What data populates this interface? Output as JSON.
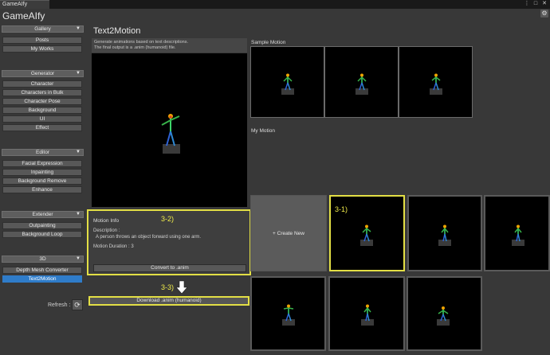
{
  "window": {
    "tab_label": "GameAIfy",
    "title": "GameAIfy",
    "controls": [
      "⋮",
      "□",
      "✕"
    ],
    "settings_icon": "gear-icon"
  },
  "sidebar": {
    "sections": [
      {
        "label": "Gallery",
        "items": [
          "Posts",
          "My Works"
        ]
      },
      {
        "label": "Generator",
        "items": [
          "Character",
          "Characters in Bulk",
          "Character Pose",
          "Background",
          "UI",
          "Effect"
        ]
      },
      {
        "label": "Editor",
        "items": [
          "Facial Expression",
          "Inpainting",
          "Background Remove",
          "Enhance"
        ]
      },
      {
        "label": "Extender",
        "items": [
          "Outpainting",
          "Background Loop"
        ]
      },
      {
        "label": "3D",
        "items": [
          "Depth Mesh Converter",
          "Text2Motion"
        ]
      }
    ],
    "active_item": "Text2Motion",
    "refresh_label": "Refresh :",
    "refresh_icon": "refresh-icon"
  },
  "main": {
    "title": "Text2Motion",
    "description_line1": "Generate animations based on text descriptions.",
    "description_line2": "The final output is a .anim (humanoid) file.",
    "motion_info": {
      "title": "Motion Info",
      "description_label": "Description :",
      "description": "A person throws an object forward using one arm.",
      "duration": "Motion Duration : 3"
    },
    "convert_label": "Convert to .anim",
    "download_label": "Download .anim (humanoid)"
  },
  "annotations": {
    "a1": "3-1)",
    "a2": "3-2)",
    "a3": "3-3)"
  },
  "sample_motion": {
    "label": "Sample Motion",
    "count": 3
  },
  "my_motion": {
    "label": "My Motion",
    "create_new": "+ Create New",
    "count": 7
  },
  "colors": {
    "accent": "#2f7cc9",
    "highlight": "#e3df45",
    "background": "#383838"
  }
}
